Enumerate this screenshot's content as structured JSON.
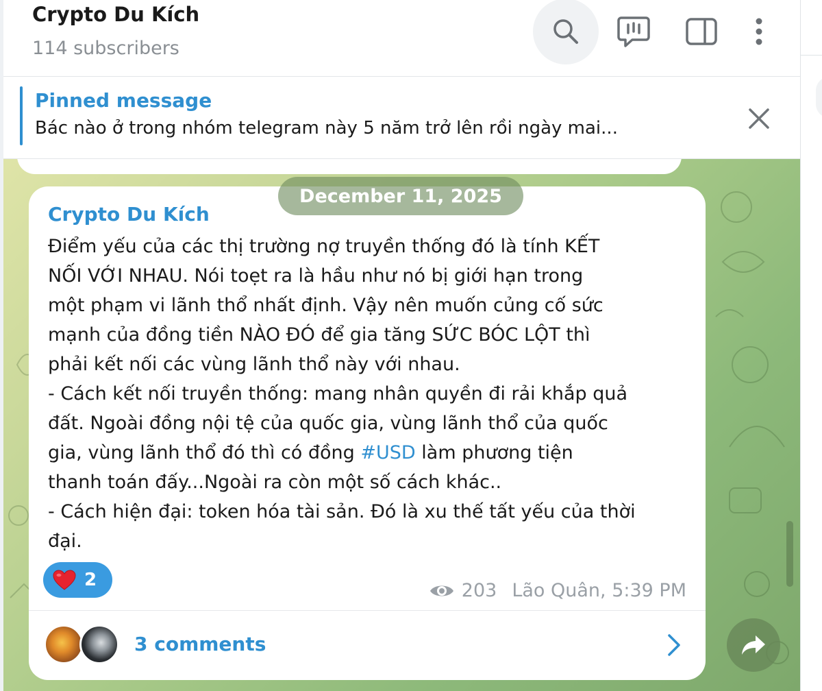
{
  "header": {
    "title": "Crypto Du Kích",
    "subtitle": "114 subscribers",
    "icons": [
      "search-icon",
      "comments-icon",
      "side-panel-icon",
      "more-icon"
    ]
  },
  "pinned": {
    "title": "Pinned message",
    "text": "Bác nào ở trong nhóm telegram này 5 năm trở lên rồi ngày mai..."
  },
  "chat": {
    "date": "December 11, 2025",
    "message": {
      "author": "Crypto Du Kích",
      "lines": [
        "Điểm yếu của các thị trường nợ truyền thống đó là tính KẾT",
        "NỐI VỚI NHAU. Nói toẹt ra là hầu như nó bị giới hạn trong",
        "một phạm vi lãnh thổ nhất định. Vậy nên muốn củng cố sức",
        "mạnh của đồng tiền NÀO ĐÓ để gia tăng SỨC BÓC LỘT thì",
        "phải kết nối các vùng lãnh thổ này với nhau.",
        "- Cách kết nối truyền thống: mang nhân quyền đi rải khắp quả",
        "đất. Ngoài đồng nội tệ của quốc gia, vùng lãnh thổ của quốc"
      ],
      "line8_before": "gia, vùng lãnh thổ đó thì có đồng ",
      "hashtag": "#USD",
      "line8_after": " làm phương tiện",
      "lines_end": [
        "thanh toán đấy...Ngoài ra còn một số cách khác..",
        "- Cách hiện đại: token hóa tài sản. Đó là xu thế tất yếu của thời",
        "đại."
      ],
      "reaction": {
        "emoji": "❤️",
        "count": "2"
      },
      "views": "203",
      "signature": "Lão Quân, 5:39 PM",
      "comments_label": "3 comments"
    }
  },
  "colors": {
    "accent": "#2f8fd0",
    "reaction_bg": "#3a9be0",
    "date_pill_bg": "#6f8c5f"
  }
}
